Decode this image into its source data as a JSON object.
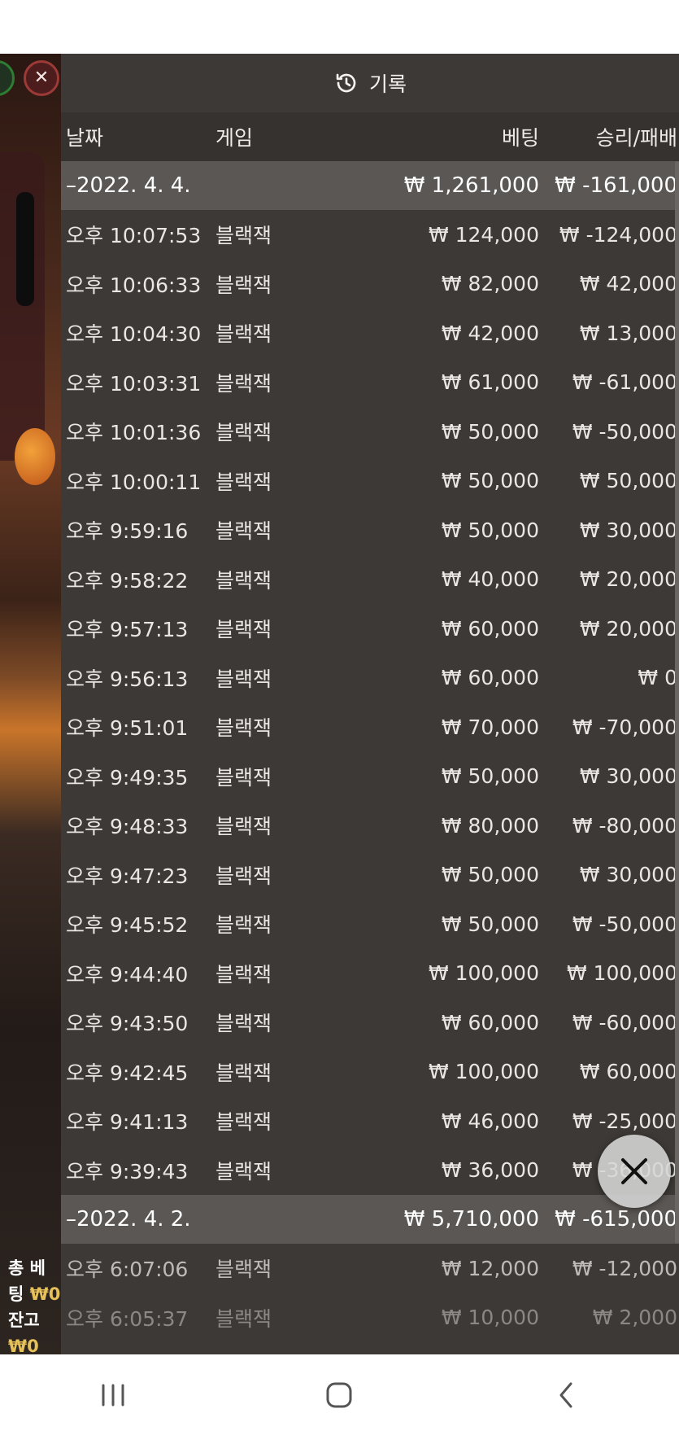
{
  "side": {
    "total_bet_label": "총 베팅",
    "total_bet_value": "₩0",
    "balance_label": "잔고",
    "balance_value": "₩0"
  },
  "header": {
    "title": "기록",
    "icon": "history-icon"
  },
  "columns": {
    "date": "날짜",
    "game": "게임",
    "bet": "베팅",
    "win": "승리/패배"
  },
  "groups": [
    {
      "date": "–2022. 4. 4.",
      "bet": "₩ 1,261,000",
      "win": "₩ -161,000",
      "rows": [
        {
          "time": "오후 10:07:53",
          "game": "블랙잭",
          "bet": "₩ 124,000",
          "win": "₩ -124,000"
        },
        {
          "time": "오후 10:06:33",
          "game": "블랙잭",
          "bet": "₩ 82,000",
          "win": "₩ 42,000"
        },
        {
          "time": "오후 10:04:30",
          "game": "블랙잭",
          "bet": "₩ 42,000",
          "win": "₩ 13,000"
        },
        {
          "time": "오후 10:03:31",
          "game": "블랙잭",
          "bet": "₩ 61,000",
          "win": "₩ -61,000"
        },
        {
          "time": "오후 10:01:36",
          "game": "블랙잭",
          "bet": "₩ 50,000",
          "win": "₩ -50,000"
        },
        {
          "time": "오후 10:00:11",
          "game": "블랙잭",
          "bet": "₩ 50,000",
          "win": "₩ 50,000"
        },
        {
          "time": "오후 9:59:16",
          "game": "블랙잭",
          "bet": "₩ 50,000",
          "win": "₩ 30,000"
        },
        {
          "time": "오후 9:58:22",
          "game": "블랙잭",
          "bet": "₩ 40,000",
          "win": "₩ 20,000"
        },
        {
          "time": "오후 9:57:13",
          "game": "블랙잭",
          "bet": "₩ 60,000",
          "win": "₩ 20,000"
        },
        {
          "time": "오후 9:56:13",
          "game": "블랙잭",
          "bet": "₩ 60,000",
          "win": "₩ 0"
        },
        {
          "time": "오후 9:51:01",
          "game": "블랙잭",
          "bet": "₩ 70,000",
          "win": "₩ -70,000"
        },
        {
          "time": "오후 9:49:35",
          "game": "블랙잭",
          "bet": "₩ 50,000",
          "win": "₩ 30,000"
        },
        {
          "time": "오후 9:48:33",
          "game": "블랙잭",
          "bet": "₩ 80,000",
          "win": "₩ -80,000"
        },
        {
          "time": "오후 9:47:23",
          "game": "블랙잭",
          "bet": "₩ 50,000",
          "win": "₩ 30,000"
        },
        {
          "time": "오후 9:45:52",
          "game": "블랙잭",
          "bet": "₩ 50,000",
          "win": "₩ -50,000"
        },
        {
          "time": "오후 9:44:40",
          "game": "블랙잭",
          "bet": "₩ 100,000",
          "win": "₩ 100,000"
        },
        {
          "time": "오후 9:43:50",
          "game": "블랙잭",
          "bet": "₩ 60,000",
          "win": "₩ -60,000"
        },
        {
          "time": "오후 9:42:45",
          "game": "블랙잭",
          "bet": "₩ 100,000",
          "win": "₩ 60,000"
        },
        {
          "time": "오후 9:41:13",
          "game": "블랙잭",
          "bet": "₩ 46,000",
          "win": "₩ -25,000"
        },
        {
          "time": "오후 9:39:43",
          "game": "블랙잭",
          "bet": "₩ 36,000",
          "win": "₩ -36,000"
        }
      ]
    },
    {
      "date": "–2022. 4. 2.",
      "bet": "₩ 5,710,000",
      "win": "₩ -615,000",
      "rows": [
        {
          "time": "오후 6:07:06",
          "game": "블랙잭",
          "bet": "₩ 12,000",
          "win": "₩ -12,000"
        },
        {
          "time": "오후 6:05:37",
          "game": "블랙잭",
          "bet": "₩ 10,000",
          "win": "₩ 2,000"
        }
      ]
    }
  ],
  "fab": {
    "icon": "close-icon"
  },
  "navbar": {
    "recent": "recent-apps-icon",
    "home": "home-icon",
    "back": "back-icon"
  }
}
